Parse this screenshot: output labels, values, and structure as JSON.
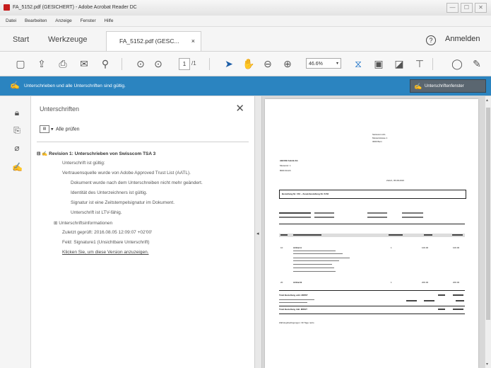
{
  "window": {
    "title": "FA_5152.pdf (GESICHERT) - Adobe Acrobat Reader DC",
    "controls": [
      "—",
      "☐",
      "✕"
    ]
  },
  "menu": [
    "Datei",
    "Bearbeiten",
    "Anzeige",
    "Fenster",
    "Hilfe"
  ],
  "tabs": {
    "start": "Start",
    "tools": "Werkzeuge",
    "document": "FA_5152.pdf (GESC...",
    "close": "×",
    "help": "?",
    "signin": "Anmelden"
  },
  "toolbar": {
    "icons": [
      "bookmark-icon",
      "upload-icon",
      "print-icon",
      "mail-icon",
      "search-icon",
      "page-up-icon",
      "page-down-icon",
      "cursor-icon",
      "hand-icon",
      "zoom-out-icon",
      "zoom-in-icon",
      "fit-icon",
      "scan-icon",
      "export-icon",
      "stamp-icon",
      "comment-icon",
      "pen-icon"
    ],
    "page_current": "1",
    "page_total": "/1",
    "zoom": "46.6%",
    "zoom_dropdown": "▾"
  },
  "signature_bar": {
    "message": "Unterschrieben und alle Unterschriften sind gültig.",
    "panel_button": "Unterschriftenfenster",
    "accent": "#2b84c0"
  },
  "panel": {
    "title": "Unterschriften",
    "close": "✕",
    "verify_all": "Alle prüfen",
    "tree": [
      {
        "text": "Revision 1: Unterschrieben von Swisscom TSA 3",
        "bold": true
      },
      {
        "text": "Unterschrift ist gültig:",
        "bold": false
      },
      {
        "text": "Vertrauensquelle wurde von Adobe Approved Trust List (AATL).",
        "bold": false
      },
      {
        "text": "Dokument wurde nach dem Unterschreiben nicht mehr geändert.",
        "bold": false
      },
      {
        "text": "Identität des Unterzeichners ist gültig.",
        "bold": false
      },
      {
        "text": "Signatur ist eine Zeitstempelsignatur im Dokument.",
        "bold": false
      },
      {
        "text": "Unterschrift ist LTV-fähig.",
        "bold": false
      },
      {
        "text": "Unterschriftsinformationen",
        "bold": false
      },
      {
        "text": "Zuletzt geprüft: 2016.08.05 12:09:07 +02'00'",
        "bold": false
      },
      {
        "text": "Feld: Signature1 (Unsichtbare Unterschrift)",
        "bold": false
      },
      {
        "text": "Klicken Sie, um diese Version anzuzeigen.",
        "bold": false,
        "link": true
      }
    ]
  },
  "left_rail": [
    "lock-icon",
    "page-copy-icon",
    "attachment-icon",
    "signature-icon"
  ],
  "document": {
    "sender": [
      "Swisscom AG",
      "Musterstrasse 1",
      "3000 Bern"
    ],
    "recipient": [
      "ABCDE Fabrik AG",
      "Musterstr. 1",
      "8000 Zürich"
    ],
    "date": "Zürich, 05.08.2016",
    "header": "Bestellung Nr. 152 – Zusatzbestellung Nr. 5152",
    "items": [
      {
        "pos": "10",
        "desc": "Artikel A",
        "qty": "1",
        "price": "100.00",
        "total": "100.00"
      },
      {
        "pos": "20",
        "desc": "Artikel B",
        "qty": "1",
        "price": "200.00",
        "total": "200.00"
      }
    ],
    "subtotal": "Total Bestellung exkl. MWST",
    "total": "Total Bestellung inkl. MWST",
    "footer": "Zahlungsbedingungen: 30 Tage netto"
  }
}
